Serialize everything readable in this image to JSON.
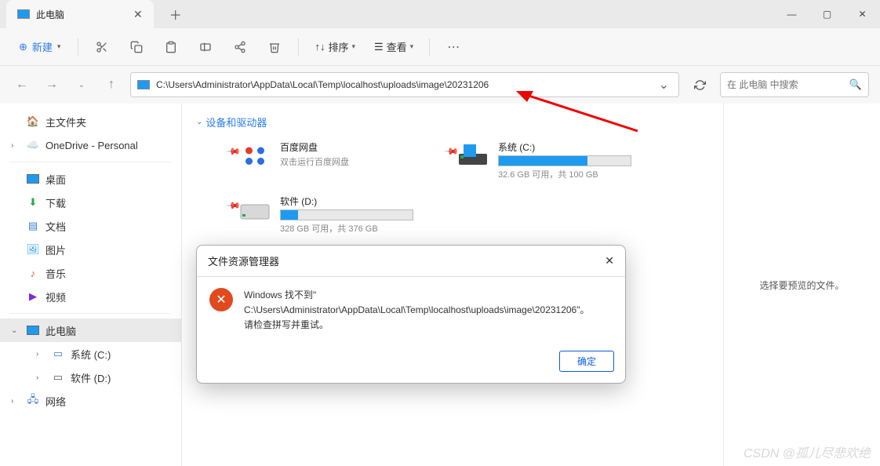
{
  "titlebar": {
    "tab_title": "此电脑"
  },
  "toolbar": {
    "new_label": "新建",
    "sort_label": "排序",
    "view_label": "查看"
  },
  "address": {
    "path": "C:\\Users\\Administrator\\AppData\\Local\\Temp\\localhost\\uploads\\image\\20231206"
  },
  "search": {
    "placeholder": "在 此电脑 中搜索"
  },
  "sidebar": {
    "home": "主文件夹",
    "onedrive": "OneDrive - Personal",
    "desktop": "桌面",
    "downloads": "下载",
    "documents": "文档",
    "pictures": "图片",
    "music": "音乐",
    "videos": "视频",
    "this_pc": "此电脑",
    "drive_c": "系统 (C:)",
    "drive_d": "软件 (D:)",
    "network": "网络"
  },
  "section": {
    "devices": "设备和驱动器"
  },
  "drives": {
    "baidu": {
      "name": "百度网盘",
      "sub": "双击运行百度网盘"
    },
    "c": {
      "name": "系统 (C:)",
      "info": "32.6 GB 可用，共 100 GB",
      "fill": 67
    },
    "d": {
      "name": "软件 (D:)",
      "info": "328 GB 可用，共 376 GB",
      "fill": 13
    }
  },
  "preview": {
    "empty": "选择要预览的文件。"
  },
  "dialog": {
    "title": "文件资源管理器",
    "line1": "Windows 找不到\"",
    "line2": "C:\\Users\\Administrator\\AppData\\Local\\Temp\\localhost\\uploads\\image\\20231206\"。",
    "line3": "请检查拼写并重试。",
    "ok": "确定"
  },
  "watermark": "CSDN @孤儿尽悲欢绝"
}
